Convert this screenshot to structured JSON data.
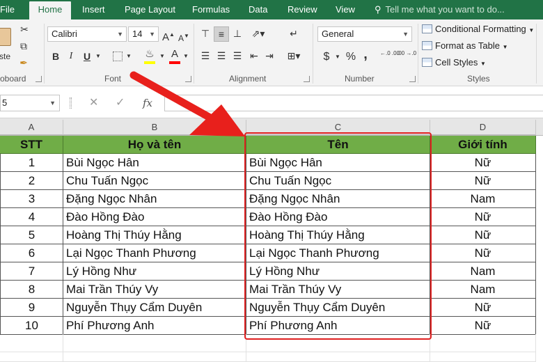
{
  "tabs": [
    {
      "label": "File"
    },
    {
      "label": "Home",
      "active": true
    },
    {
      "label": "Insert"
    },
    {
      "label": "Page Layout"
    },
    {
      "label": "Formulas"
    },
    {
      "label": "Data"
    },
    {
      "label": "Review"
    },
    {
      "label": "View"
    }
  ],
  "tell_me": "Tell me what you want to do...",
  "ribbon": {
    "clipboard": {
      "label": "oboard",
      "paste_label": "ste"
    },
    "font": {
      "label": "Font",
      "font_name": "Calibri",
      "font_size": "14",
      "bold": "B",
      "italic": "I",
      "underline": "U",
      "grow": "A",
      "shrink": "A",
      "font_color_letter": "A",
      "fill_color": "#ffff00",
      "font_color": "#ff0000"
    },
    "alignment": {
      "label": "Alignment"
    },
    "number": {
      "label": "Number",
      "format": "General",
      "currency": "$",
      "percent": "%",
      "comma": ",",
      "inc_decimals": "←.0 .00",
      "dec_decimals": ".00 →.0"
    },
    "styles": {
      "label": "Styles",
      "conditional": "Conditional Formatting",
      "format_table": "Format as Table",
      "cell_styles": "Cell Styles"
    }
  },
  "formula_bar": {
    "name_box": "5",
    "cancel": "✕",
    "enter": "✓",
    "fx": "fx",
    "content": ""
  },
  "columns": [
    "A",
    "B",
    "C",
    "D"
  ],
  "table": {
    "headers": [
      "STT",
      "Họ và tên",
      "Tên",
      "Giới tính"
    ],
    "header_color": "#70ad47",
    "rows": [
      [
        "1",
        "Bùi Ngọc Hân",
        "Bùi Ngọc Hân",
        "Nữ"
      ],
      [
        "2",
        "Chu Tuấn Ngọc",
        "Chu Tuấn Ngọc",
        "Nữ"
      ],
      [
        "3",
        "Đặng Ngọc Nhân",
        "Đặng Ngọc Nhân",
        "Nam"
      ],
      [
        "4",
        "Đào Hồng Đào",
        "Đào Hồng Đào",
        "Nữ"
      ],
      [
        "5",
        "Hoàng Thị Thúy Hằng",
        "Hoàng Thị Thúy Hằng",
        "Nữ"
      ],
      [
        "6",
        "Lại Ngọc Thanh Phương",
        "Lại Ngọc Thanh Phương",
        "Nữ"
      ],
      [
        "7",
        "Lý Hồng Như",
        "Lý Hồng Như",
        "Nam"
      ],
      [
        "8",
        "Mai Trần Thúy Vy",
        "Mai Trần Thúy Vy",
        "Nam"
      ],
      [
        "9",
        "Nguyễn Thụy Cẩm Duyên",
        "Nguyễn Thụy Cẩm Duyên",
        "Nữ"
      ],
      [
        "10",
        "Phí Phương Anh",
        "Phí Phương Anh",
        "Nữ"
      ]
    ]
  },
  "annotation": {
    "highlight_color": "#e02020",
    "arrow_color": "#e8201c"
  }
}
